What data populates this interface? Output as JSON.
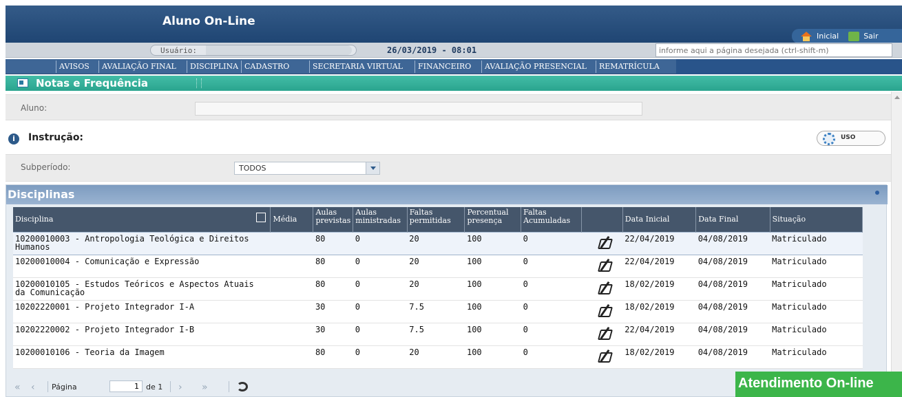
{
  "header": {
    "title": "Aluno On-Line",
    "home_label": "Inicial",
    "exit_label": "Sair"
  },
  "userbar": {
    "user_label": "Usuário:",
    "datetime": "26/03/2019 - 08:01",
    "page_placeholder": "informe aqui a página desejada (ctrl-shift-m)"
  },
  "menu": [
    "AVISOS",
    "AVALIAÇÃO FINAL",
    "DISCIPLINA",
    "CADASTRO",
    "SECRETARIA VIRTUAL",
    "FINANCEIRO",
    "AVALIAÇÃO PRESENCIAL",
    "REMATRÍCULA"
  ],
  "section": {
    "title": "Notas e Frequência"
  },
  "aluno": {
    "label": "Aluno:"
  },
  "instrucao": {
    "title": "Instrução:",
    "uso_label": "USO"
  },
  "subperiodo": {
    "label": "Subperíodo:",
    "value": "TODOS"
  },
  "panel": {
    "title": "Disciplinas"
  },
  "table": {
    "headers": [
      "Disciplina",
      "Média",
      "Aulas previstas",
      "Aulas ministradas",
      "Faltas permitidas",
      "Percentual presença",
      "Faltas Acumuladas",
      "",
      "Data Inicial",
      "Data Final",
      "Situação"
    ],
    "rows": [
      {
        "disciplina": "10200010003 - Antropologia Teológica e Direitos Humanos",
        "media": "",
        "previstas": "80",
        "ministradas": "0",
        "permitidas": "20",
        "presenca": "100",
        "acumuladas": "0",
        "inicio": "22/04/2019",
        "fim": "04/08/2019",
        "situacao": "Matriculado"
      },
      {
        "disciplina": "10200010004 - Comunicação e Expressão",
        "media": "",
        "previstas": "80",
        "ministradas": "0",
        "permitidas": "20",
        "presenca": "100",
        "acumuladas": "0",
        "inicio": "22/04/2019",
        "fim": "04/08/2019",
        "situacao": "Matriculado"
      },
      {
        "disciplina": "10200010105 - Estudos Teóricos e Aspectos Atuais da Comunicação",
        "media": "",
        "previstas": "80",
        "ministradas": "0",
        "permitidas": "20",
        "presenca": "100",
        "acumuladas": "0",
        "inicio": "18/02/2019",
        "fim": "04/08/2019",
        "situacao": "Matriculado"
      },
      {
        "disciplina": "10202220001 - Projeto Integrador I-A",
        "media": "",
        "previstas": "30",
        "ministradas": "0",
        "permitidas": "7.5",
        "presenca": "100",
        "acumuladas": "0",
        "inicio": "18/02/2019",
        "fim": "04/08/2019",
        "situacao": "Matriculado"
      },
      {
        "disciplina": "10202220002 - Projeto Integrador I-B",
        "media": "",
        "previstas": "30",
        "ministradas": "0",
        "permitidas": "7.5",
        "presenca": "100",
        "acumuladas": "0",
        "inicio": "22/04/2019",
        "fim": "04/08/2019",
        "situacao": "Matriculado"
      },
      {
        "disciplina": "10200010106 - Teoria da Imagem",
        "media": "",
        "previstas": "80",
        "ministradas": "0",
        "permitidas": "20",
        "presenca": "100",
        "acumuladas": "0",
        "inicio": "18/02/2019",
        "fim": "04/08/2019",
        "situacao": "Matriculado"
      }
    ]
  },
  "pager": {
    "page_label": "Página",
    "page_value": "1",
    "of_label": "de 1"
  },
  "chat": {
    "label": "Atendimento On-line"
  }
}
